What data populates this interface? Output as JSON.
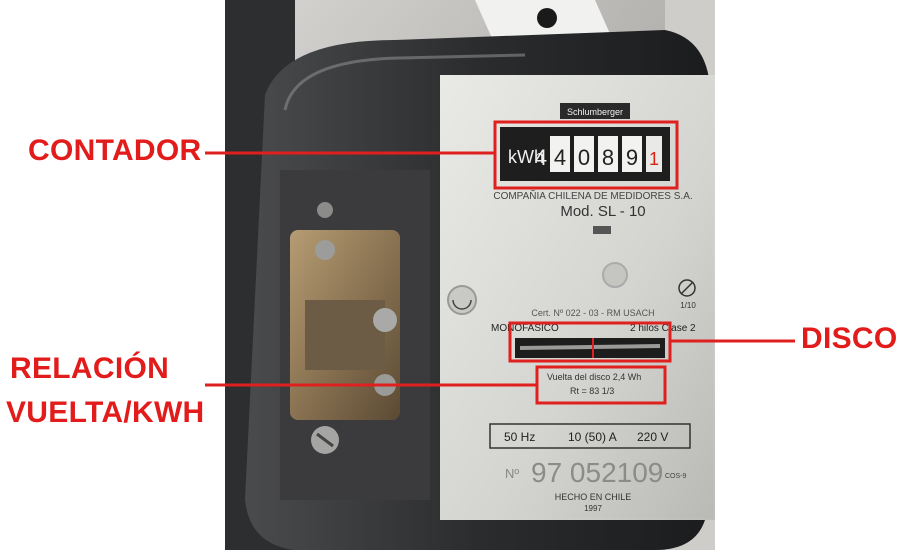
{
  "annotations": {
    "contador": "CONTADOR",
    "disco": "DISCO",
    "relacion_line1": "RELACIÓN",
    "relacion_line2": "VUELTA/KWH"
  },
  "meter": {
    "brand": "Schlumberger",
    "counter_unit": "kWh",
    "counter_digits": [
      "4",
      "4",
      "0",
      "8",
      "9",
      "1"
    ],
    "company": "COMPAÑIA CHILENA DE MEDIDORES S.A.",
    "model": "Mod. SL - 10",
    "cert": "Cert. Nº 022 - 03 - RM USACH",
    "phase": "MONOFASICO",
    "wires_class": "2 hilos Clase 2",
    "disc_revolution": "Vuelta del disco 2,4 Wh",
    "rt": "Rt = 83 1/3",
    "frequency": "50 Hz",
    "current": "10 (50) A",
    "voltage": "220 V",
    "serial_prefix": "Nº",
    "serial": "97 052109",
    "made_in": "HECHO EN CHILE",
    "year": "1997",
    "ratio_small": "1/10",
    "corner_code": "COS-9"
  },
  "colors": {
    "annotation_red": "#e21b1b",
    "box_red": "#e0201e",
    "faceplate": "#d9dad6",
    "housing": "#2a2b2d"
  }
}
